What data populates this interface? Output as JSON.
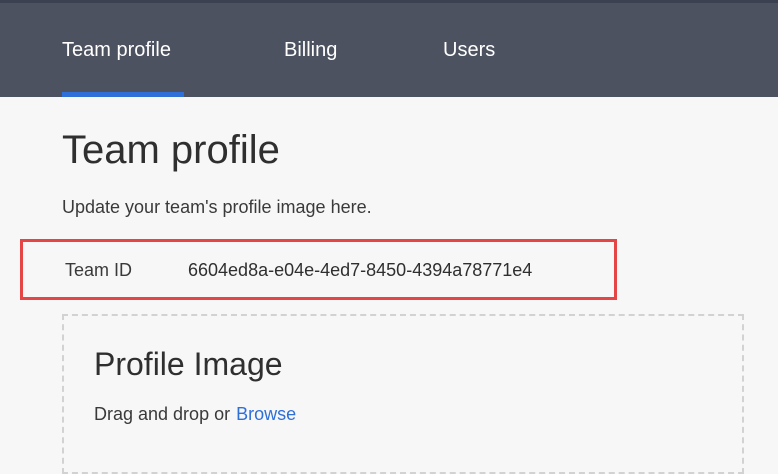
{
  "nav": {
    "tabs": [
      {
        "label": "Team profile",
        "active": true
      },
      {
        "label": "Billing",
        "active": false
      },
      {
        "label": "Users",
        "active": false
      }
    ]
  },
  "page": {
    "title": "Team profile",
    "description": "Update your team's profile image here."
  },
  "team_id": {
    "label": "Team ID",
    "value": "6604ed8a-e04e-4ed7-8450-4394a78771e4"
  },
  "profile_image": {
    "title": "Profile Image",
    "drag_text": "Drag and drop or",
    "browse_label": "Browse"
  },
  "colors": {
    "navbar": "#4d5261",
    "accent": "#2f6fd8",
    "highlight_border": "#e64545"
  }
}
